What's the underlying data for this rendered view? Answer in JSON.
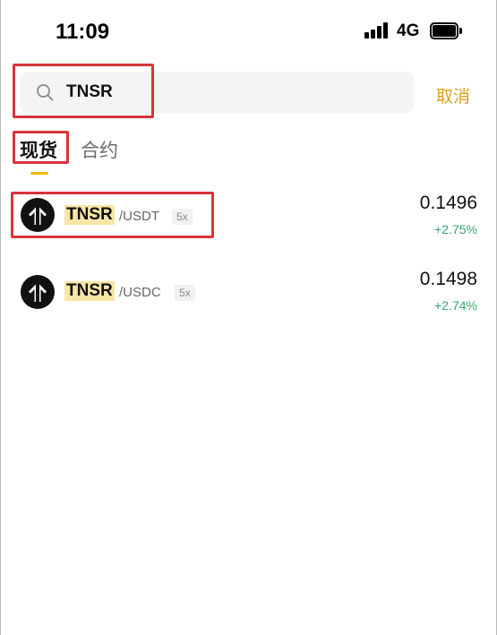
{
  "status_bar": {
    "time": "11:09",
    "network": "4G"
  },
  "search": {
    "query": "TNSR",
    "cancel_label": "取消"
  },
  "tabs": [
    {
      "label": "现货",
      "active": true
    },
    {
      "label": "合约",
      "active": false
    }
  ],
  "results": [
    {
      "base": "TNSR",
      "quote": "/USDT",
      "leverage": "5x",
      "price": "0.1496",
      "change": "+2.75%"
    },
    {
      "base": "TNSR",
      "quote": "/USDC",
      "leverage": "5x",
      "price": "0.1498",
      "change": "+2.74%"
    }
  ],
  "colors": {
    "accent": "#f0b90b",
    "cancel": "#d9a21b",
    "positive": "#35a86d",
    "highlight_box": "#d6343c"
  }
}
